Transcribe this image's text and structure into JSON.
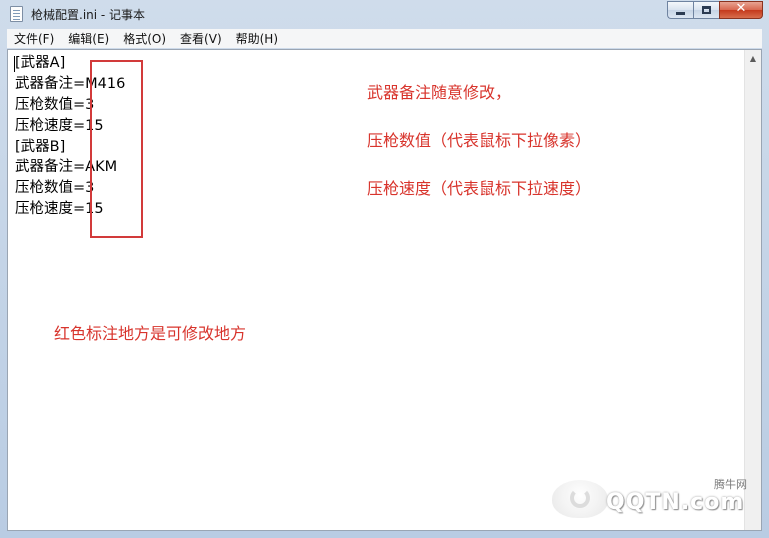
{
  "window": {
    "title": "枪械配置.ini - 记事本",
    "caption": {
      "minimize": "",
      "maximize": "",
      "close": "✕"
    }
  },
  "menu": [
    {
      "label": "文件(F)"
    },
    {
      "label": "编辑(E)"
    },
    {
      "label": "格式(O)"
    },
    {
      "label": "查看(V)"
    },
    {
      "label": "帮助(H)"
    }
  ],
  "content": {
    "lines": [
      "[武器A]",
      "武器备注=M416",
      "压枪数值=3",
      "压枪速度=15",
      "[武器B]",
      "武器备注=AKM",
      "压枪数值=3",
      "压枪速度=15"
    ]
  },
  "annotations": {
    "note1": "武器备注随意修改，",
    "note2": "压枪数值（代表鼠标下拉像素）",
    "note3": "压枪速度（代表鼠标下拉速度）",
    "note4": "红色标注地方是可修改地方",
    "highlight_color": "#d23a3a"
  },
  "scrollbar": {
    "up_arrow": "▲"
  },
  "watermark": {
    "brand": "QQTN.com",
    "site": "腾牛网"
  }
}
